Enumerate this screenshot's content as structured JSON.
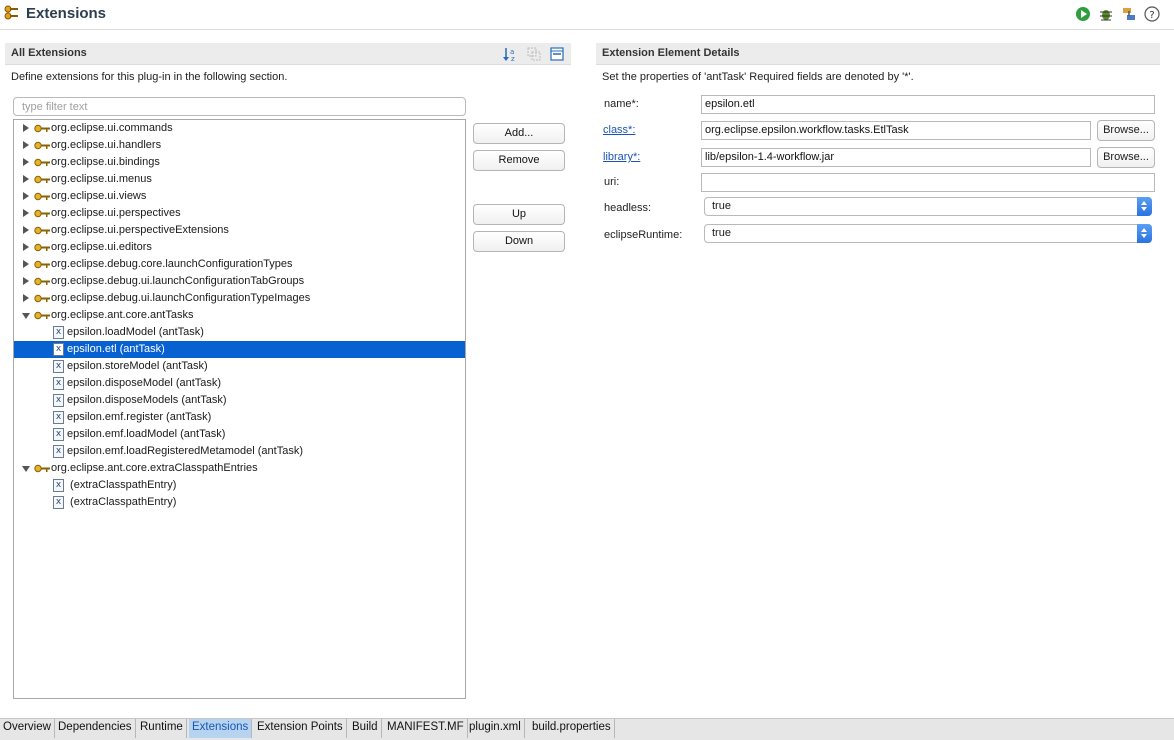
{
  "header": {
    "title": "Extensions",
    "tools": [
      "run-icon",
      "debug-icon",
      "export-icon",
      "help-icon"
    ]
  },
  "all_extensions": {
    "title": "All Extensions",
    "description": "Define extensions for this plug-in in the following section.",
    "filter_placeholder": "type filter text",
    "tools": [
      "sort-icon",
      "expand-all-icon",
      "collapse-all-icon"
    ],
    "tree": [
      {
        "label": "org.eclipse.ui.commands",
        "level": 0,
        "expanded": false
      },
      {
        "label": "org.eclipse.ui.handlers",
        "level": 0,
        "expanded": false
      },
      {
        "label": "org.eclipse.ui.bindings",
        "level": 0,
        "expanded": false
      },
      {
        "label": "org.eclipse.ui.menus",
        "level": 0,
        "expanded": false
      },
      {
        "label": "org.eclipse.ui.views",
        "level": 0,
        "expanded": false
      },
      {
        "label": "org.eclipse.ui.perspectives",
        "level": 0,
        "expanded": false
      },
      {
        "label": "org.eclipse.ui.perspectiveExtensions",
        "level": 0,
        "expanded": false
      },
      {
        "label": "org.eclipse.ui.editors",
        "level": 0,
        "expanded": false
      },
      {
        "label": "org.eclipse.debug.core.launchConfigurationTypes",
        "level": 0,
        "expanded": false
      },
      {
        "label": "org.eclipse.debug.ui.launchConfigurationTabGroups",
        "level": 0,
        "expanded": false
      },
      {
        "label": "org.eclipse.debug.ui.launchConfigurationTypeImages",
        "level": 0,
        "expanded": false
      },
      {
        "label": "org.eclipse.ant.core.antTasks",
        "level": 0,
        "expanded": true
      },
      {
        "label": "epsilon.loadModel (antTask)",
        "level": 1
      },
      {
        "label": "epsilon.etl (antTask)",
        "level": 1,
        "selected": true
      },
      {
        "label": "epsilon.storeModel (antTask)",
        "level": 1
      },
      {
        "label": "epsilon.disposeModel (antTask)",
        "level": 1
      },
      {
        "label": "epsilon.disposeModels (antTask)",
        "level": 1
      },
      {
        "label": "epsilon.emf.register (antTask)",
        "level": 1
      },
      {
        "label": "epsilon.emf.loadModel (antTask)",
        "level": 1
      },
      {
        "label": "epsilon.emf.loadRegisteredMetamodel (antTask)",
        "level": 1
      },
      {
        "label": "org.eclipse.ant.core.extraClasspathEntries",
        "level": 0,
        "expanded": true
      },
      {
        "label": " (extraClasspathEntry)",
        "level": 1
      },
      {
        "label": " (extraClasspathEntry)",
        "level": 1
      }
    ],
    "buttons": {
      "add": "Add...",
      "remove": "Remove",
      "up": "Up",
      "down": "Down"
    }
  },
  "details": {
    "title": "Extension Element Details",
    "description": "Set the properties of 'antTask' Required fields are denoted by '*'.",
    "fields": {
      "name_label": "name*:",
      "name_value": "epsilon.etl",
      "class_label": "class*:",
      "class_value": "org.eclipse.epsilon.workflow.tasks.EtlTask",
      "library_label": "library*:",
      "library_value": "lib/epsilon-1.4-workflow.jar",
      "uri_label": "uri:",
      "uri_value": "",
      "headless_label": "headless:",
      "headless_value": "true",
      "eclipse_runtime_label": "eclipseRuntime:",
      "eclipse_runtime_value": "true",
      "browse_label": "Browse..."
    }
  },
  "tabs": [
    {
      "label": "Overview"
    },
    {
      "label": "Dependencies"
    },
    {
      "label": "Runtime"
    },
    {
      "label": "Extensions",
      "active": true
    },
    {
      "label": "Extension Points"
    },
    {
      "label": "Build"
    },
    {
      "label": "MANIFEST.MF"
    },
    {
      "label": "plugin.xml"
    },
    {
      "label": "build.properties"
    }
  ]
}
